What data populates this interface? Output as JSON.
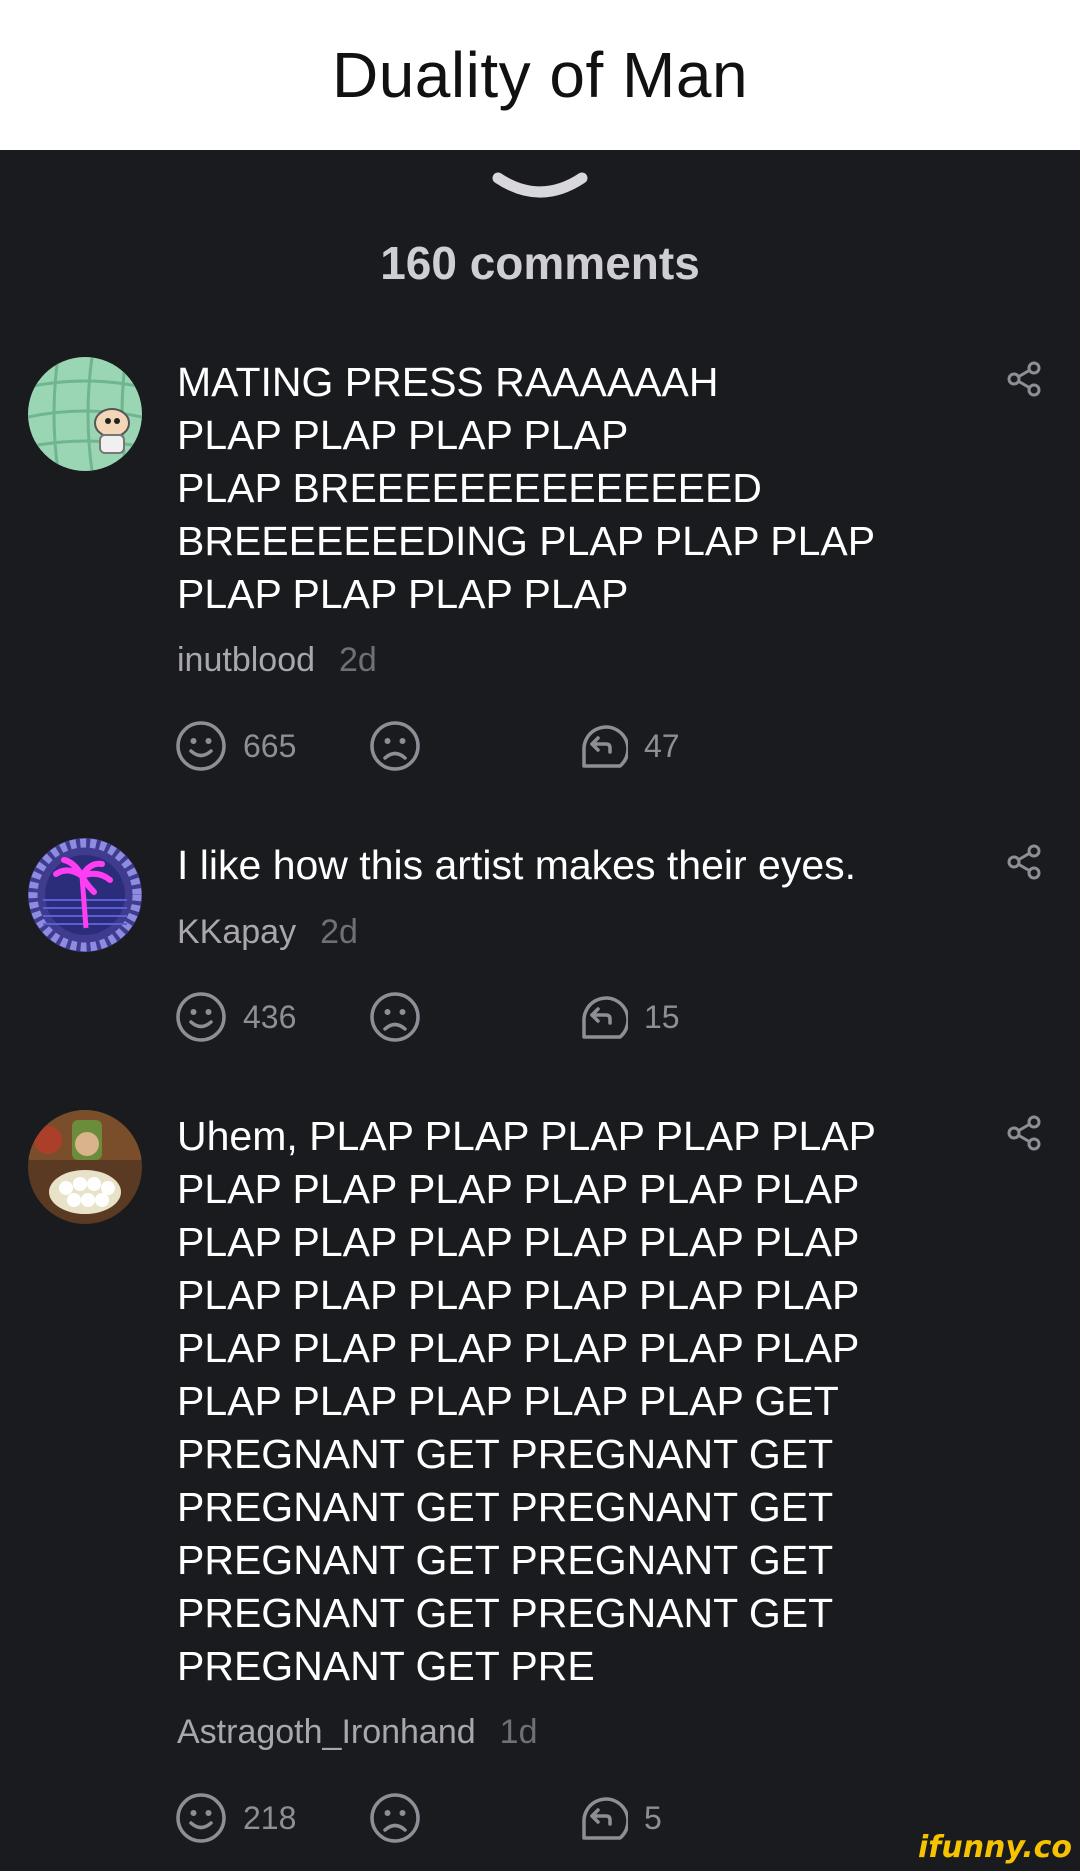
{
  "post": {
    "title": "Duality of Man"
  },
  "comments_header": {
    "count_label": "160 comments"
  },
  "colors": {
    "background": "#1a1b1f",
    "text": "#ffffff",
    "muted": "#a7a7ad",
    "icon": "#8e8f96",
    "watermark": "#f7c300"
  },
  "comments": [
    {
      "text": "MATING PRESS RAAAAAAH\nPLAP PLAP PLAP PLAP\nPLAP BREEEEEEEEEEEEEED\nBREEEEEEEDING PLAP PLAP PLAP\nPLAP PLAP PLAP PLAP",
      "author": "inutblood",
      "time": "2d",
      "likes": "665",
      "replies": "47",
      "avatar_icon": "cartoon-avatar-icon"
    },
    {
      "text": "I like how this artist makes their eyes.",
      "author": "KKapay",
      "time": "2d",
      "likes": "436",
      "replies": "15",
      "avatar_icon": "palm-tree-avatar-icon"
    },
    {
      "text": "Uhem, PLAP PLAP PLAP PLAP PLAP\nPLAP PLAP PLAP PLAP PLAP PLAP\nPLAP PLAP PLAP PLAP PLAP PLAP\nPLAP PLAP PLAP PLAP PLAP PLAP\nPLAP PLAP PLAP PLAP PLAP PLAP\nPLAP PLAP PLAP PLAP PLAP GET\nPREGNANT GET PREGNANT GET\nPREGNANT GET PREGNANT GET\nPREGNANT GET PREGNANT GET\nPREGNANT GET PREGNANT GET\nPREGNANT GET PRE",
      "author": "Astragoth_Ironhand",
      "time": "1d",
      "likes": "218",
      "replies": "5",
      "avatar_icon": "warrior-avatar-icon"
    }
  ],
  "watermark": "ifunny.co"
}
